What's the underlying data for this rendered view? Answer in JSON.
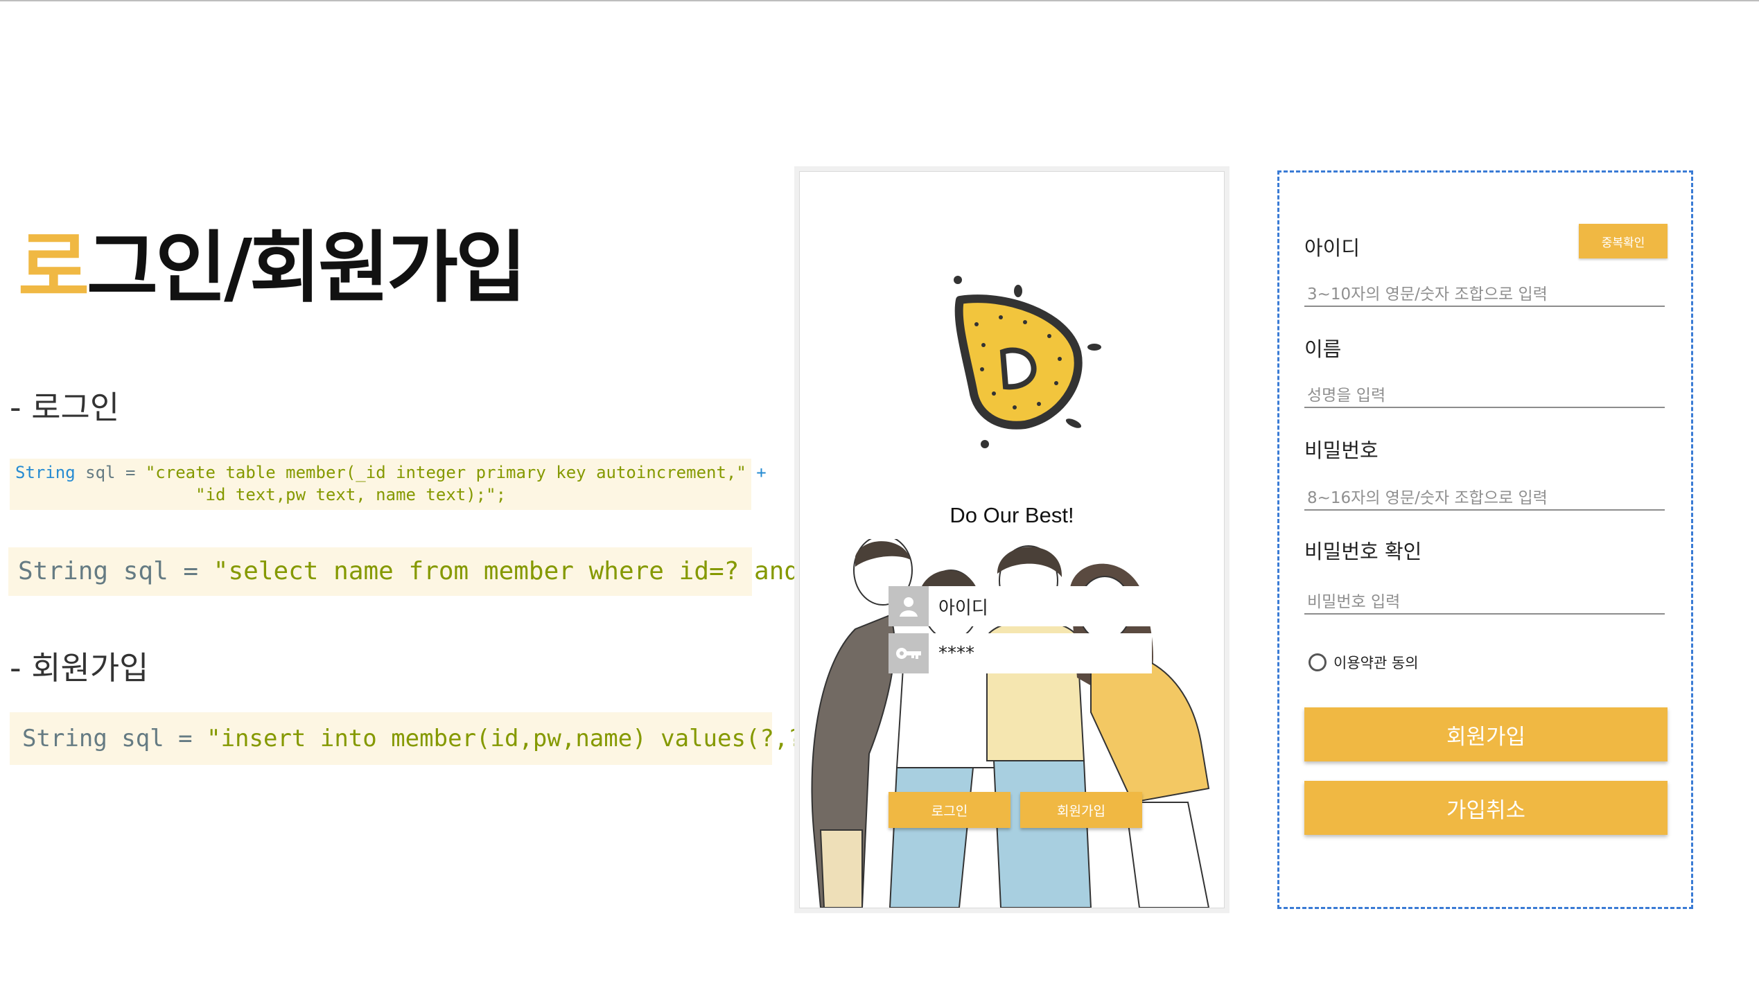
{
  "slide": {
    "title_accent": "로",
    "title_rest": "그인/회원가입",
    "section_login": "- 로그인",
    "section_signup": "- 회원가입"
  },
  "code": {
    "create_table": {
      "line1_keyword": "String",
      "line1_mid": " sql = ",
      "line1_string": "\"create table member(_id integer primary key autoincrement,\"",
      "line1_plus": " +",
      "line2_string": "                  \"id text,pw text, name text);\";"
    },
    "select": {
      "prefix": "String sql = ",
      "string": "\"select name from member where id=? and pw=?;\";"
    },
    "insert": {
      "prefix": "String sql = ",
      "string": "\"insert into member(id,pw,name) values(?,?,?);\";"
    }
  },
  "login_screen": {
    "tagline": "Do Our Best!",
    "id_field": "아이디",
    "pw_field": "****",
    "login_button": "로그인",
    "signup_button": "회원가입",
    "accent_color": "#f0b843"
  },
  "signup_screen": {
    "id_label": "아이디",
    "dup_check_button": "중복확인",
    "id_placeholder": "3~10자의 영문/숫자 조합으로 입력",
    "name_label": "이름",
    "name_placeholder": "성명을 입력",
    "pw_label": "비밀번호",
    "pw_placeholder": "8~16자의 영문/숫자 조합으로 입력",
    "pw_confirm_label": "비밀번호 확인",
    "pw_confirm_placeholder": "비밀번호 입력",
    "agree_label": "이용약관 동의",
    "submit_button": "회원가입",
    "cancel_button": "가입취소"
  }
}
